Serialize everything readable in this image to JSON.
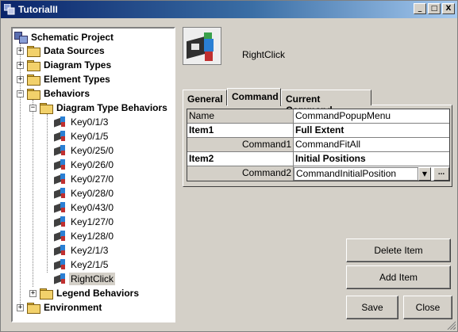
{
  "window": {
    "title": "TutorialII",
    "min_glyph": "_",
    "max_glyph": "□",
    "close_glyph": "X"
  },
  "tree": {
    "root": "Schematic Project",
    "data_sources": "Data Sources",
    "diagram_types": "Diagram Types",
    "element_types": "Element Types",
    "behaviors": "Behaviors",
    "diagram_type_behaviors": "Diagram Type Behaviors",
    "behavior_items": [
      "Key0/1/3",
      "Key0/1/5",
      "Key0/25/0",
      "Key0/26/0",
      "Key0/27/0",
      "Key0/28/0",
      "Key0/43/0",
      "Key1/27/0",
      "Key1/28/0",
      "Key2/1/3",
      "Key2/1/5",
      "RightClick"
    ],
    "legend_behaviors": "Legend Behaviors",
    "environment": "Environment",
    "plus": "+",
    "minus": "−"
  },
  "header": {
    "title": "RightClick"
  },
  "tabs": {
    "general": "General",
    "command": "Command",
    "current_command": "Current Command"
  },
  "props": {
    "name_key": "Name",
    "name_val": "CommandPopupMenu",
    "item1_key": "Item1",
    "item1_val": "Full Extent",
    "cmd1_key": "Command1",
    "cmd1_val": "CommandFitAll",
    "item2_key": "Item2",
    "item2_val": "Initial Positions",
    "cmd2_key": "Command2",
    "cmd2_val": "CommandInitialPosition",
    "arrow_glyph": "▼",
    "ellipsis": "..."
  },
  "buttons": {
    "delete_item": "Delete Item",
    "add_item": "Add Item",
    "save": "Save",
    "close": "Close"
  }
}
